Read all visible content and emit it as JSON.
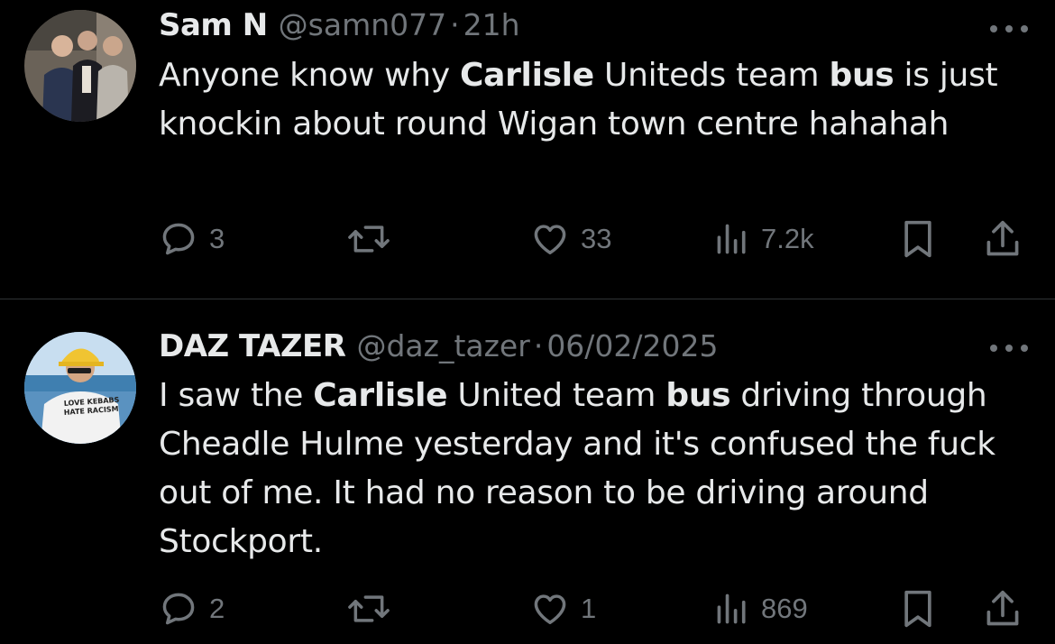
{
  "tweets": [
    {
      "name": "Sam N",
      "handle": "@samn077",
      "separator": "·",
      "time": "21h",
      "text": [
        {
          "t": "Anyone know why ",
          "b": false
        },
        {
          "t": "Carlisle",
          "b": true
        },
        {
          "t": " Uniteds team ",
          "b": false
        },
        {
          "t": "bus",
          "b": true
        },
        {
          "t": " is just knockin about round Wigan town centre hahahah",
          "b": false
        }
      ],
      "replies": "3",
      "reposts": "",
      "likes": "33",
      "views": "7.2k"
    },
    {
      "name": "DAZ TAZER",
      "handle": "@daz_tazer",
      "separator": "·",
      "time": "06/02/2025",
      "text": [
        {
          "t": "I saw the ",
          "b": false
        },
        {
          "t": "Carlisle",
          "b": true
        },
        {
          "t": " United team ",
          "b": false
        },
        {
          "t": "bus",
          "b": true
        },
        {
          "t": " driving through Cheadle Hulme yesterday and it's confused the fuck out of me. It had no reason to be driving around Stockport.",
          "b": false
        }
      ],
      "replies": "2",
      "reposts": "",
      "likes": "1",
      "views": "869"
    }
  ],
  "icons": {
    "reply": "speech-bubble-icon",
    "repost": "repost-arrows-icon",
    "like": "heart-icon",
    "views": "bar-chart-icon",
    "bookmark": "bookmark-icon",
    "share": "share-upload-icon",
    "more": "more-dots-icon"
  },
  "colors": {
    "background": "#000000",
    "text": "#e7e9ea",
    "muted": "#71767b",
    "divider": "#2f3336"
  }
}
